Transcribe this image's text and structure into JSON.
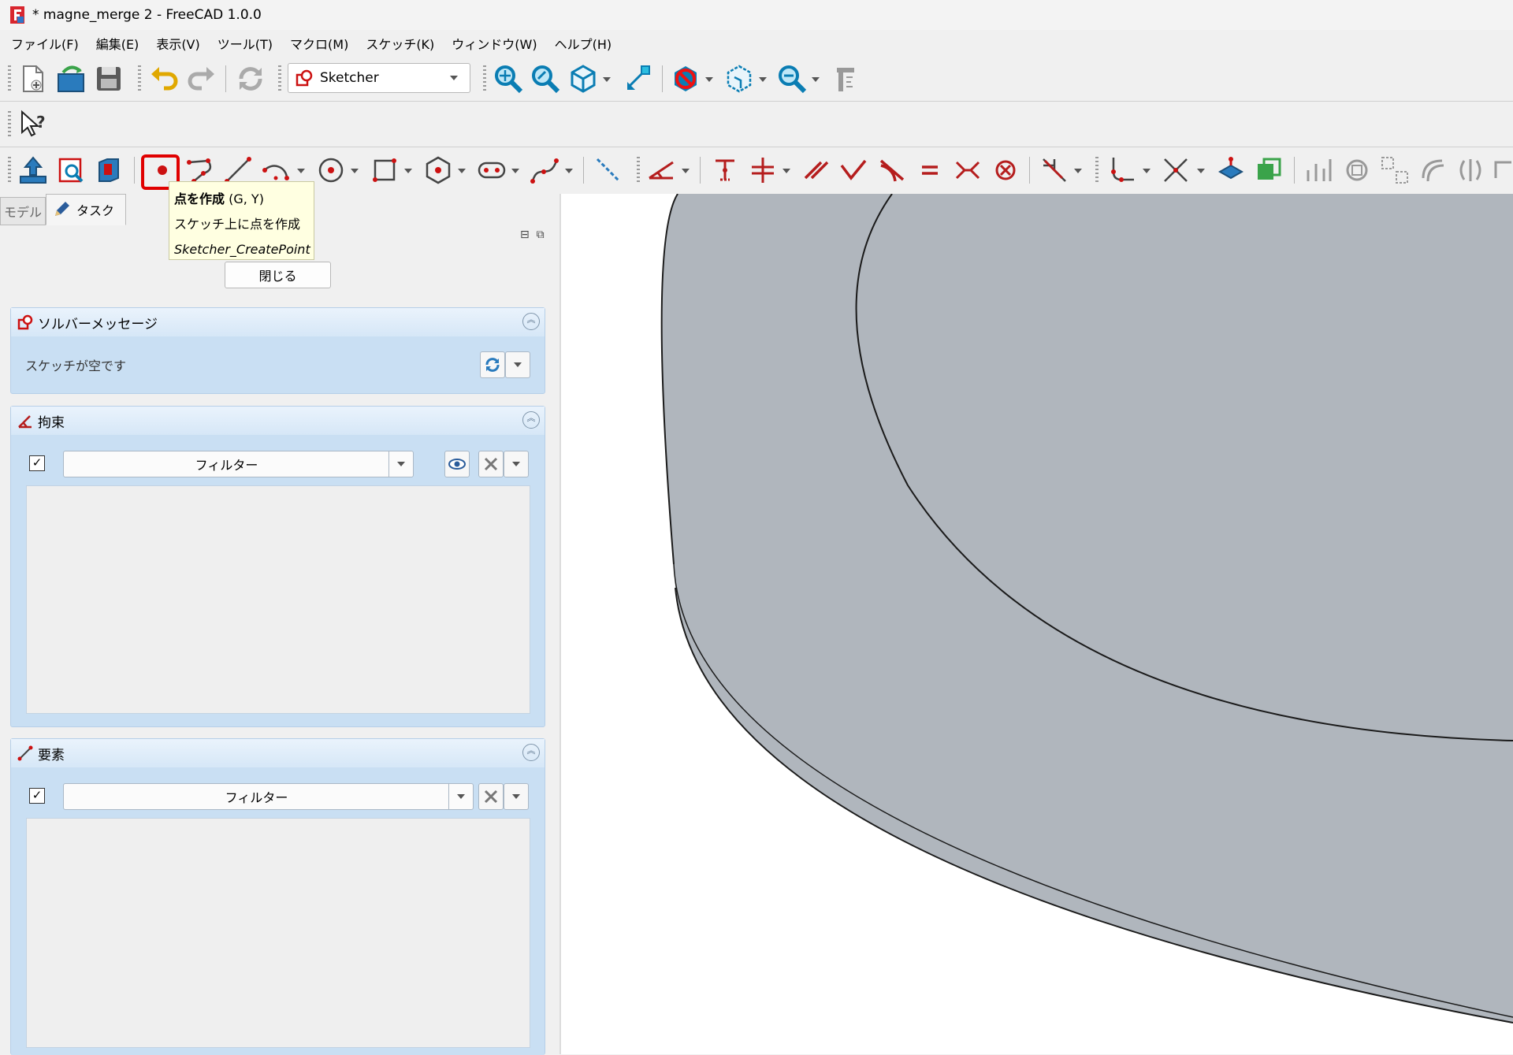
{
  "window": {
    "title": "* magne_merge 2 - FreeCAD 1.0.0"
  },
  "menu": [
    "ファイル(F)",
    "編集(E)",
    "表示(V)",
    "ツール(T)",
    "マクロ(M)",
    "スケッチ(K)",
    "ウィンドウ(W)",
    "ヘルプ(H)"
  ],
  "workbench": {
    "selected": "Sketcher"
  },
  "tooltip": {
    "title": "点を作成",
    "shortcut": "(G, Y)",
    "description": "スケッチ上に点を作成",
    "command": "Sketcher_CreatePoint"
  },
  "tabs": {
    "model": "モデル",
    "task": "タスク"
  },
  "task": {
    "close_label": "閉じる"
  },
  "solver_panel": {
    "title": "ソルバーメッセージ",
    "message": "スケッチが空です"
  },
  "constraints_panel": {
    "title": "拘束",
    "filter_label": "フィルター",
    "checked": true
  },
  "elements_panel": {
    "title": "要素",
    "filter_label": "フィルター",
    "checked": true
  },
  "colors": {
    "accent": "#e00000",
    "panel_blue": "#c9dff3",
    "model_gray": "#b0b6bd",
    "sketch_red": "#b51d1d"
  }
}
